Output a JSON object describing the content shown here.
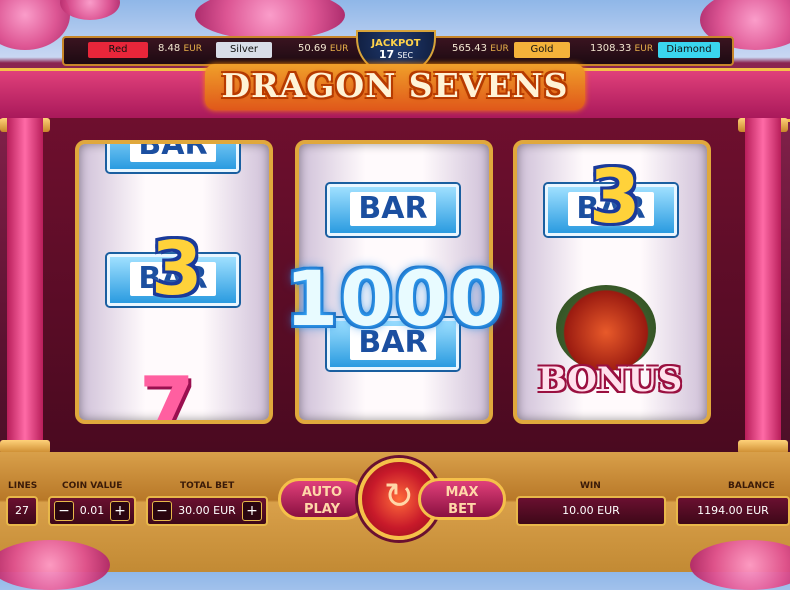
{
  "jackpots": [
    {
      "name": "Red",
      "amount": "8.48",
      "currency": "EUR",
      "color": "#e8263a"
    },
    {
      "name": "Silver",
      "amount": "50.69",
      "currency": "EUR",
      "color": "#d8dde8"
    },
    {
      "name": "Gold",
      "amount": "565.43",
      "currency": "EUR",
      "color": "#f4b23a"
    },
    {
      "name": "Diamond",
      "amount": "1308.33",
      "currency": "EUR",
      "color": "#3ad6ef"
    }
  ],
  "jackpot_timer": {
    "label": "JACKPOT",
    "value": "17",
    "unit": "SEC"
  },
  "game_title": "DRAGON SEVENS",
  "reels": {
    "reel1": {
      "top_symbol": "BAR",
      "middle_symbol": "BAR",
      "middle_multiplier": "3",
      "bottom_symbol": "7"
    },
    "reel2": {
      "top_symbol": "BAR",
      "bottom_symbol": "BAR"
    },
    "reel3": {
      "top_symbol": "BAR",
      "top_multiplier": "3",
      "bottom_symbol": "BONUS"
    }
  },
  "win_amount_display": "1000",
  "controls": {
    "lines_label": "LINES",
    "lines_value": "27",
    "coin_value_label": "COIN VALUE",
    "coin_value": "0.01",
    "total_bet_label": "TOTAL BET",
    "total_bet_value": "30.00 EUR",
    "minus": "−",
    "plus": "+",
    "autoplay_line1": "AUTO",
    "autoplay_line2": "PLAY",
    "maxbet_line1": "MAX",
    "maxbet_line2": "BET",
    "spin_icon": "↻",
    "win_label": "WIN",
    "win_value": "10.00 EUR",
    "balance_label": "BALANCE",
    "balance_value": "1194.00 EUR"
  }
}
